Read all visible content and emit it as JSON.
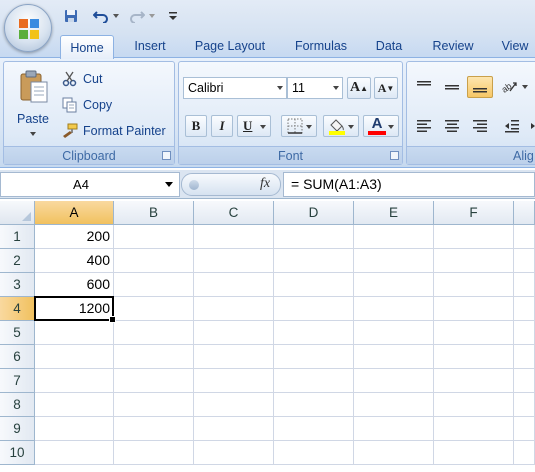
{
  "quick_access": {
    "save_icon": "save-icon",
    "undo_icon": "undo-icon",
    "redo_icon": "redo-icon",
    "customize_icon": "customize-icon"
  },
  "tabs": [
    "Home",
    "Insert",
    "Page Layout",
    "Formulas",
    "Data",
    "Review",
    "View"
  ],
  "clipboard": {
    "paste_label": "Paste",
    "cut_label": "Cut",
    "copy_label": "Copy",
    "format_painter_label": "Format Painter",
    "group_label": "Clipboard"
  },
  "font": {
    "font_name": "Calibri",
    "font_size": "11",
    "grow_label": "A",
    "shrink_label": "A",
    "bold_label": "B",
    "italic_label": "I",
    "underline_label": "U",
    "font_color_label": "A",
    "group_label": "Font"
  },
  "alignment": {
    "group_label": "Alig"
  },
  "formula_bar": {
    "name_box": "A4",
    "fx_label": "fx",
    "formula": "= SUM(A1:A3)"
  },
  "grid": {
    "columns": [
      "A",
      "B",
      "C",
      "D",
      "E",
      "F"
    ],
    "rows": [
      "1",
      "2",
      "3",
      "4",
      "5",
      "6",
      "7",
      "8",
      "9",
      "10"
    ],
    "cells": {
      "A1": "200",
      "A2": "400",
      "A3": "600",
      "A4": "1200"
    },
    "active_cell": "A4"
  },
  "colors": {
    "ribbon_text": "#15428b",
    "highlight": "#f1c15f",
    "fill_color": "#ffff00",
    "font_color": "#ff0000"
  }
}
